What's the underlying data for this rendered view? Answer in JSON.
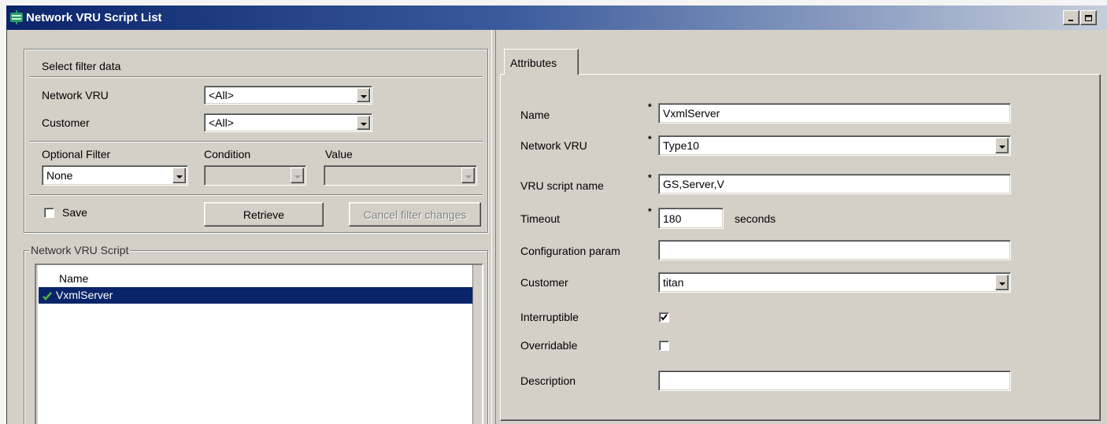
{
  "colors": {
    "title_start": "#0a246a",
    "title_end": "#c5cedb",
    "face": "#d4d0c8",
    "selection": "#0a246a",
    "check_green": "#4fb33a",
    "disabled_text": "#808080"
  },
  "window": {
    "title": "Network VRU Script List",
    "icon": "network-vru-icon",
    "control_icons": [
      "minimize-icon",
      "maximize-icon"
    ]
  },
  "filter": {
    "title": "Select filter data",
    "network_vru": {
      "label": "Network VRU",
      "value": "<All>"
    },
    "customer": {
      "label": "Customer",
      "value": "<All>"
    },
    "optional_filter": {
      "label": "Optional Filter",
      "value": "None"
    },
    "condition": {
      "label": "Condition",
      "value": "",
      "disabled": true
    },
    "value": {
      "label": "Value",
      "value": "",
      "disabled": true
    },
    "save": {
      "label": "Save",
      "checked": false
    },
    "retrieve_button": {
      "label": "Retrieve"
    },
    "cancel_button": {
      "label": "Cancel filter changes",
      "disabled": true
    }
  },
  "script_list": {
    "title": "Network VRU Script",
    "columns": [
      "Name"
    ],
    "rows": [
      {
        "name": "VxmlServer",
        "selected": true,
        "icon": "green-check-icon"
      }
    ]
  },
  "attributes": {
    "tab_label": "Attributes",
    "required_marker": "*",
    "name": {
      "label": "Name",
      "value": "VxmlServer",
      "required": true
    },
    "network_vru": {
      "label": "Network VRU",
      "value": "Type10",
      "required": true
    },
    "vru_script_name": {
      "label": "VRU script name",
      "value": "GS,Server,V",
      "required": true
    },
    "timeout": {
      "label": "Timeout",
      "value": "180",
      "unit": "seconds",
      "required": true
    },
    "configuration_param": {
      "label": "Configuration param",
      "value": ""
    },
    "customer": {
      "label": "Customer",
      "value": "titan"
    },
    "interruptible": {
      "label": "Interruptible",
      "checked": true
    },
    "overridable": {
      "label": "Overridable",
      "checked": false
    },
    "description": {
      "label": "Description",
      "value": ""
    }
  }
}
